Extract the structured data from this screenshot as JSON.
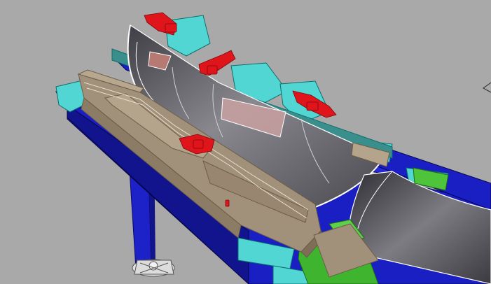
{
  "viewport": {
    "kind": "3D CAD model viewport (shaded with edges)",
    "background_color": "#a9a9a9"
  },
  "scene": {
    "parts": [
      {
        "name": "blue-steel-frame",
        "color": "#1a1fc4"
      },
      {
        "name": "cyan-mounting-brackets",
        "color": "#52d6d3"
      },
      {
        "name": "tan-fixture-base",
        "color": "#a2917a"
      },
      {
        "name": "gray-curved-panel",
        "color": "#5b5b60"
      },
      {
        "name": "red-toggle-clamps",
        "color": "#e0141b"
      },
      {
        "name": "green-locating-blocks",
        "color": "#3fb52f"
      },
      {
        "name": "pink-locator-pad",
        "color": "#c9a0a0"
      },
      {
        "name": "leveling-foot",
        "color": "#d8d8d8"
      }
    ],
    "toggle_clamp_count": 5,
    "view_cube_icon": "orientation-cube-icon"
  }
}
